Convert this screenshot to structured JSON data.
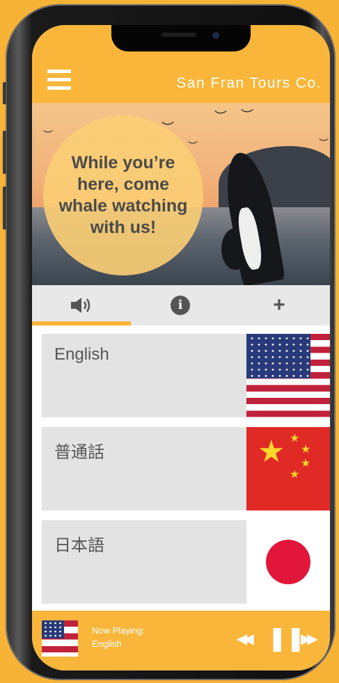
{
  "header": {
    "brand": "San Fran Tours Co."
  },
  "hero": {
    "headline": "While you’re here, come whale watching with us!"
  },
  "tabs": [
    {
      "id": "audio",
      "icon": "speaker-icon",
      "active": true
    },
    {
      "id": "info",
      "icon": "info-icon",
      "glyph": "i"
    },
    {
      "id": "add",
      "icon": "plus-icon",
      "glyph": "+"
    }
  ],
  "languages": [
    {
      "label": "English",
      "flag": "usa-flag"
    },
    {
      "label": "普通話",
      "flag": "china-flag"
    },
    {
      "label": "日本語",
      "flag": "japan-flag"
    }
  ],
  "player": {
    "status_label": "Now Playing:",
    "track": "English",
    "controls": {
      "rewind": "◀◀",
      "pause": "❚❚",
      "fast_forward": "▶▶"
    }
  },
  "colors": {
    "accent": "#f9b63a",
    "card": "#e3e3e3",
    "tab_bar": "#e8e8e8",
    "text": "#555555"
  }
}
